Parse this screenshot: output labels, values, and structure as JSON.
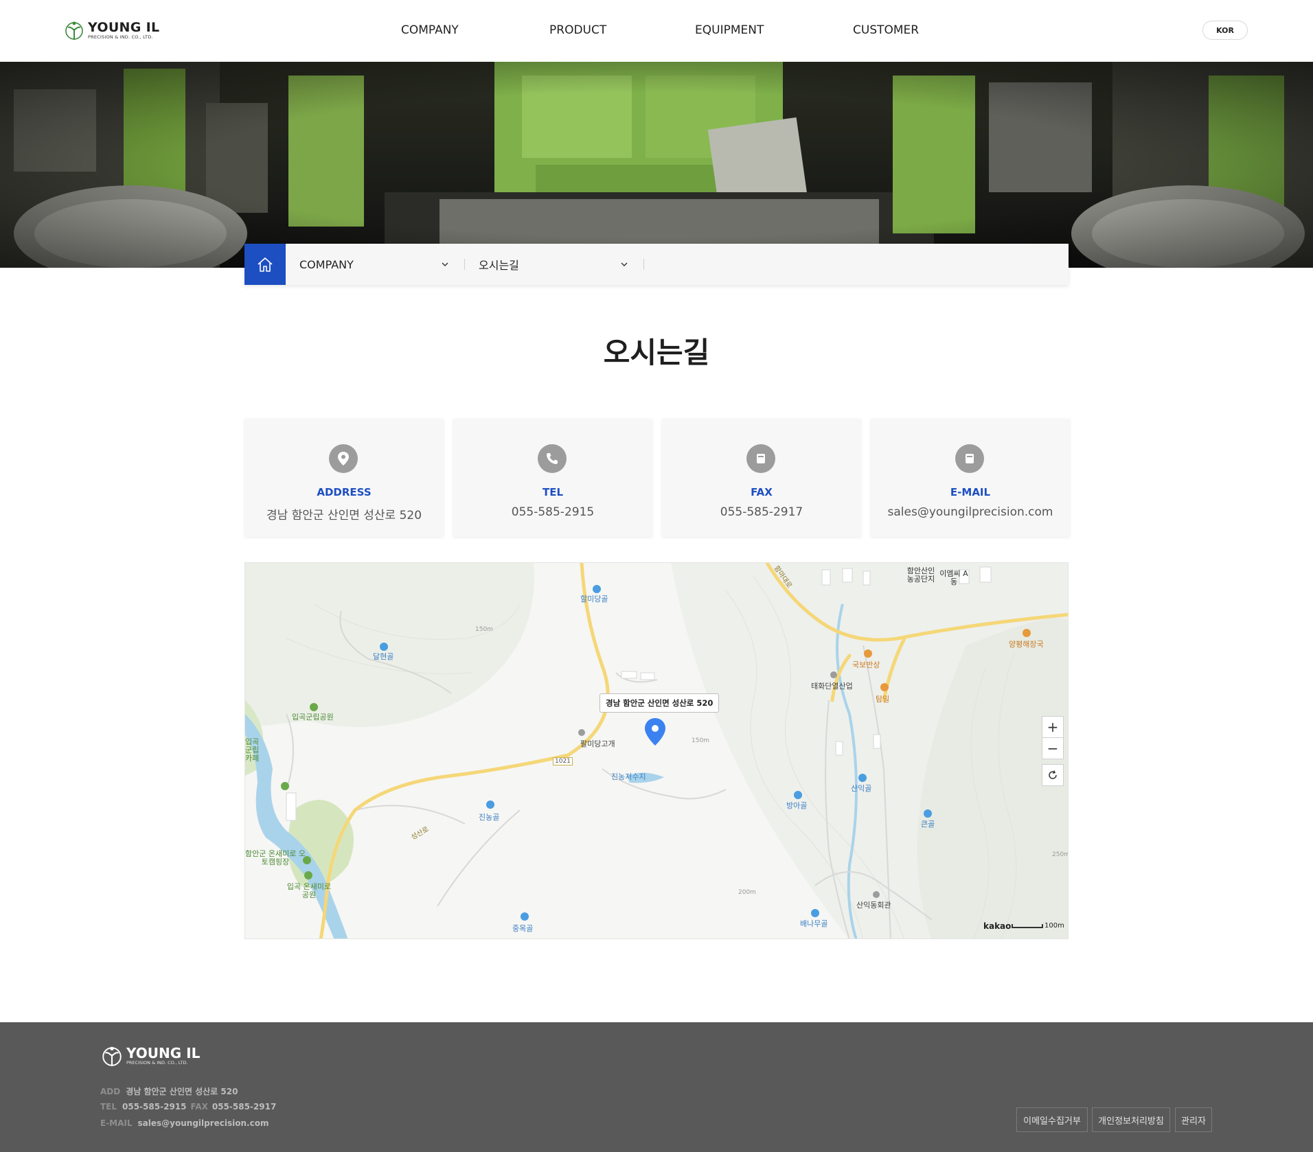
{
  "header": {
    "logo_name": "YOUNG IL",
    "logo_sub": "PRECISION & IND. CO., LTD.",
    "nav": [
      {
        "label": "COMPANY"
      },
      {
        "label": "PRODUCT"
      },
      {
        "label": "EQUIPMENT"
      },
      {
        "label": "CUSTOMER"
      }
    ],
    "lang": "KOR"
  },
  "breadcrumb": {
    "home_icon": "home-icon",
    "level1": "COMPANY",
    "level2": "오시는길"
  },
  "page_title": "오시는길",
  "contact_cards": [
    {
      "icon": "location-pin-icon",
      "label": "ADDRESS",
      "value": "경남 함안군 산인면 성산로 520"
    },
    {
      "icon": "phone-icon",
      "label": "TEL",
      "value": "055-585-2915"
    },
    {
      "icon": "fax-icon",
      "label": "FAX",
      "value": "055-585-2917"
    },
    {
      "icon": "mail-icon",
      "label": "E-MAIL",
      "value": "sales@youngilprecision.com"
    }
  ],
  "map": {
    "callout": "경남 함안군 산인면 성산로 520",
    "labels": {
      "l1": "할미당골",
      "l2": "달현골",
      "l3": "입곡군립공원",
      "l4": "입곡군립 카페",
      "l5": "팔미당고개",
      "l6": "진농저수지",
      "l7": "진농골",
      "l8": "함안군 온새미로 오토캠핑장",
      "l9": "입곡 온새미로공원",
      "l10": "중목골",
      "l11": "함안산인 농공단지",
      "l12": "이엠씨 A동",
      "l13": "양평해장국",
      "l14": "국보반상",
      "l15": "태화단열산업",
      "l16": "탐밀",
      "l17": "산익골",
      "l18": "방아골",
      "l19": "큰골",
      "l20": "산익동회관",
      "l21": "배나무골",
      "road1": "1021",
      "road2": "성산로",
      "road3": "함마대로",
      "c150a": "150m",
      "c150b": "150m",
      "c200": "200m",
      "c250": "250m"
    },
    "zoom_in": "+",
    "zoom_out": "−",
    "reset_icon": "refresh-icon",
    "brand": "kakao",
    "scale": "100m",
    "colors": {
      "road": "#f5d778",
      "water": "#a9d3ea",
      "green": "#cfe3b8",
      "poi": "#4a9de0",
      "food": "#e79a3c"
    }
  },
  "footer": {
    "logo_name": "YOUNG IL",
    "logo_sub": "PRECISION & IND. CO., LTD.",
    "add_key": "ADD",
    "add_val": "경남 함안군 산인면 성산로 520",
    "tel_key": "TEL",
    "tel_val": "055-585-2915",
    "fax_key": "FAX",
    "fax_val": "055-585-2917",
    "email_key": "E-MAIL",
    "email_val": "sales@youngilprecision.com",
    "links": [
      "이메일수집거부",
      "개인정보처리방침",
      "관리자"
    ]
  },
  "colors": {
    "accent": "#1d4fc2",
    "footer_bg": "#595959",
    "card_bg": "#f7f7f7"
  }
}
